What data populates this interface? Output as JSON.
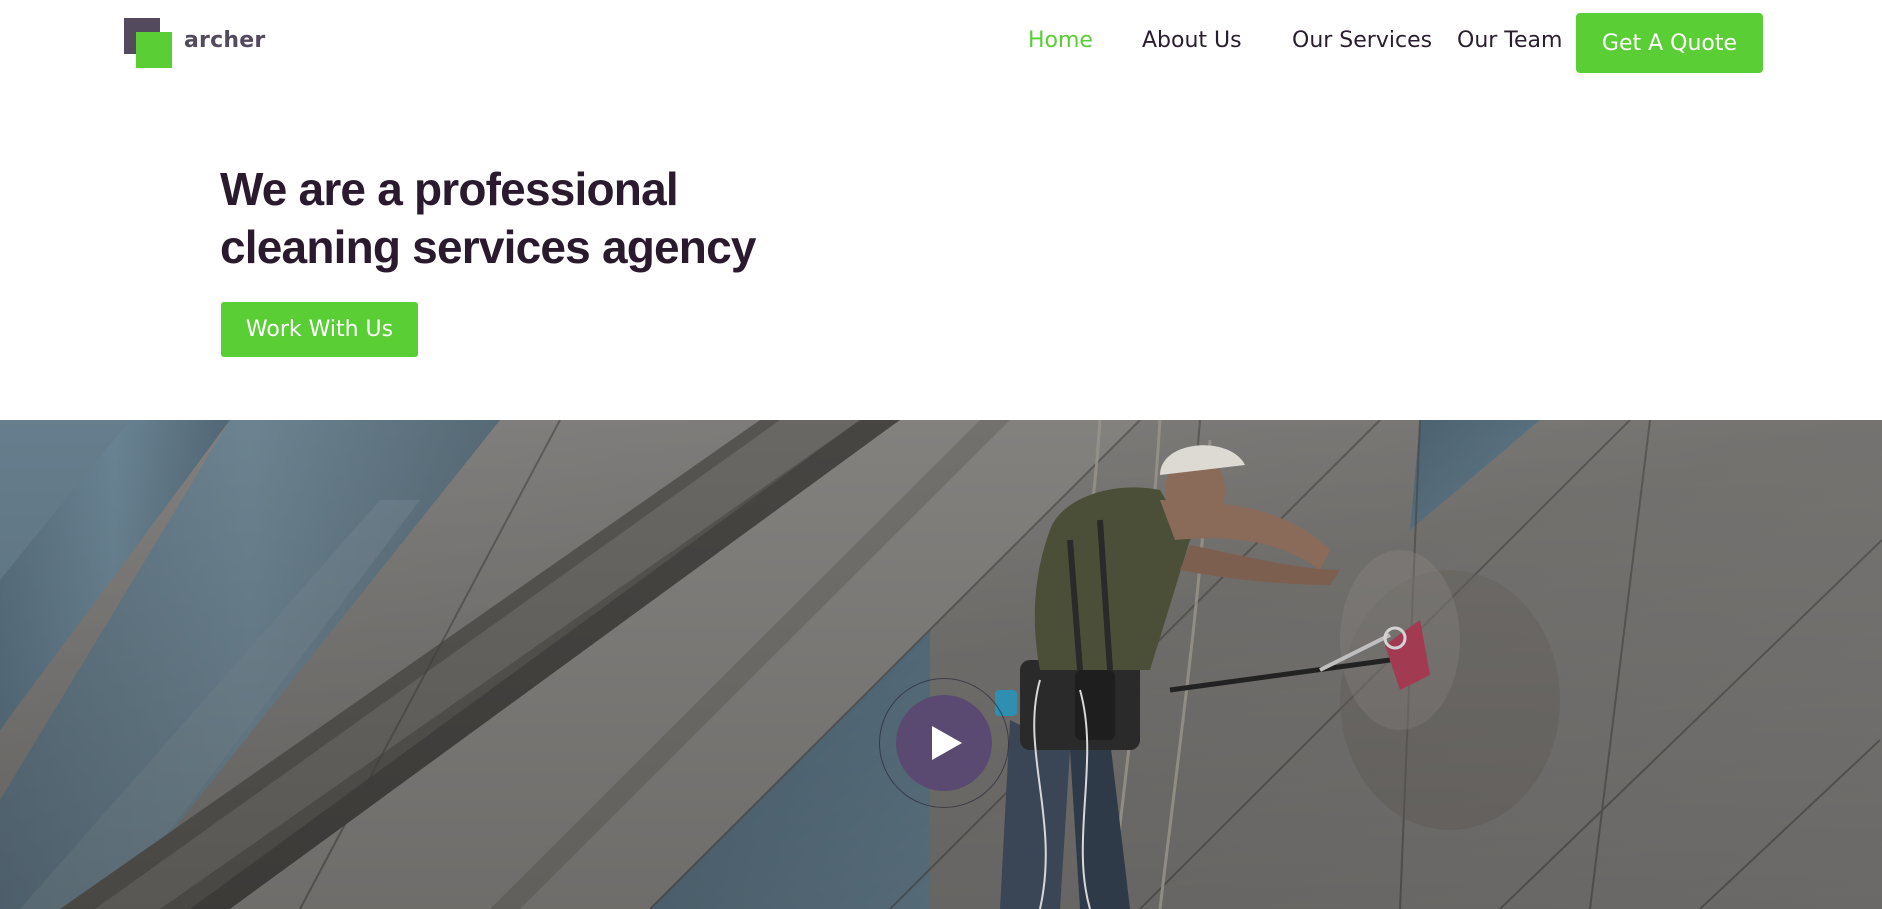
{
  "brand": {
    "name": "archer",
    "colors": {
      "accent": "#5ace35",
      "dark": "#534a5e",
      "heading": "#2a1a2e",
      "play_button": "#5a4a72"
    }
  },
  "nav": {
    "items": [
      {
        "label": "Home",
        "active": true
      },
      {
        "label": "About Us",
        "active": false
      },
      {
        "label": "Our Services",
        "active": false
      },
      {
        "label": "Our Team",
        "active": false
      }
    ],
    "cta_label": "Get A Quote"
  },
  "hero": {
    "title_line1": "We are a professional",
    "title_line2": "cleaning services agency",
    "button_label": "Work With Us"
  },
  "media": {
    "play_icon": "play-icon"
  }
}
